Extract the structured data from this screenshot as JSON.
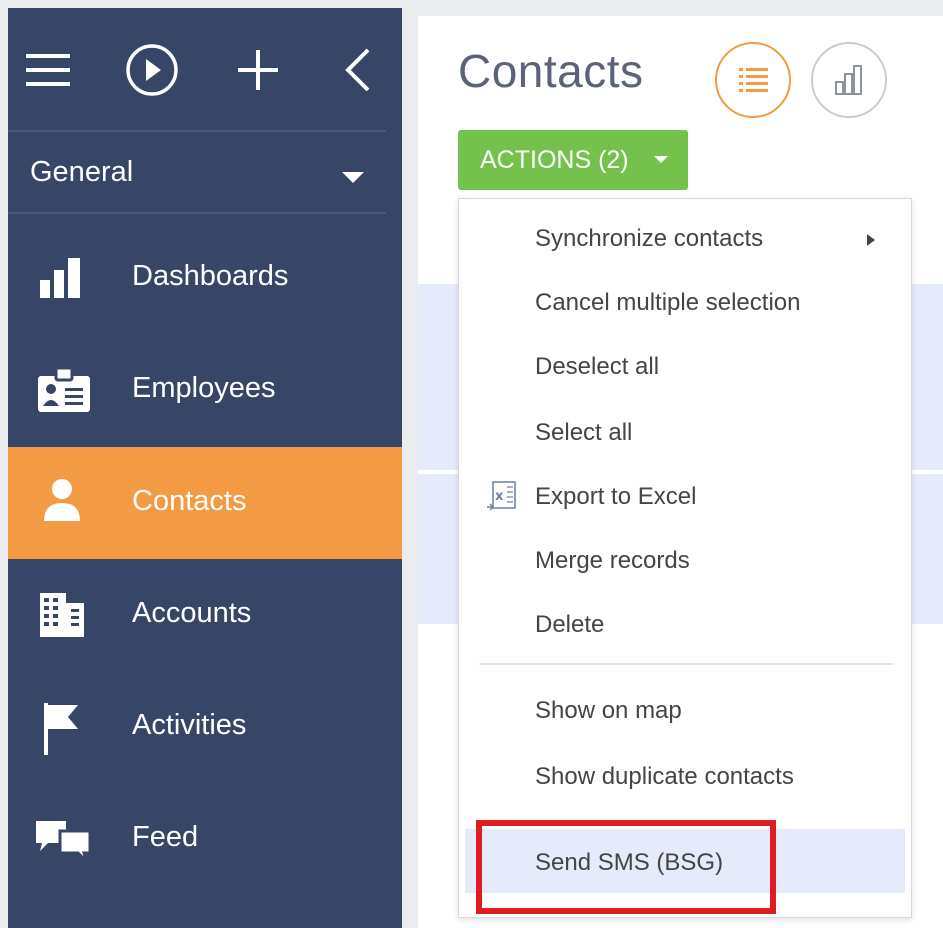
{
  "sidebar": {
    "workspace": "General",
    "items": [
      {
        "label": "Dashboards",
        "icon": "bar-chart-icon"
      },
      {
        "label": "Employees",
        "icon": "id-badge-icon"
      },
      {
        "label": "Contacts",
        "icon": "person-icon",
        "active": true
      },
      {
        "label": "Accounts",
        "icon": "building-icon"
      },
      {
        "label": "Activities",
        "icon": "flag-icon"
      },
      {
        "label": "Feed",
        "icon": "chat-bubbles-icon"
      }
    ]
  },
  "topbar": {
    "icons": [
      "menu-icon",
      "play-icon",
      "plus-icon",
      "collapse-arrow-icon"
    ]
  },
  "main": {
    "title": "Contacts",
    "view_buttons": [
      "list-view-icon",
      "analytics-view-icon"
    ],
    "actions_label": "ACTIONS (2)"
  },
  "menu": {
    "items": [
      {
        "label": "Synchronize contacts",
        "has_submenu": true
      },
      {
        "label": "Cancel multiple selection"
      },
      {
        "label": "Deselect all"
      },
      {
        "label": "Select all"
      },
      {
        "label": "Export to Excel",
        "icon": "excel-export-icon"
      },
      {
        "label": "Merge records"
      },
      {
        "label": "Delete"
      },
      {
        "label": "Show on map"
      },
      {
        "label": "Show duplicate contacts"
      },
      {
        "label": "Send SMS (BSG)",
        "highlighted": true
      }
    ]
  },
  "colors": {
    "sidebar_bg": "#374667",
    "active_item": "#f39a44",
    "actions_button": "#74c24d",
    "highlight_border": "#e01b22",
    "selected_row": "#e6ebfb"
  }
}
